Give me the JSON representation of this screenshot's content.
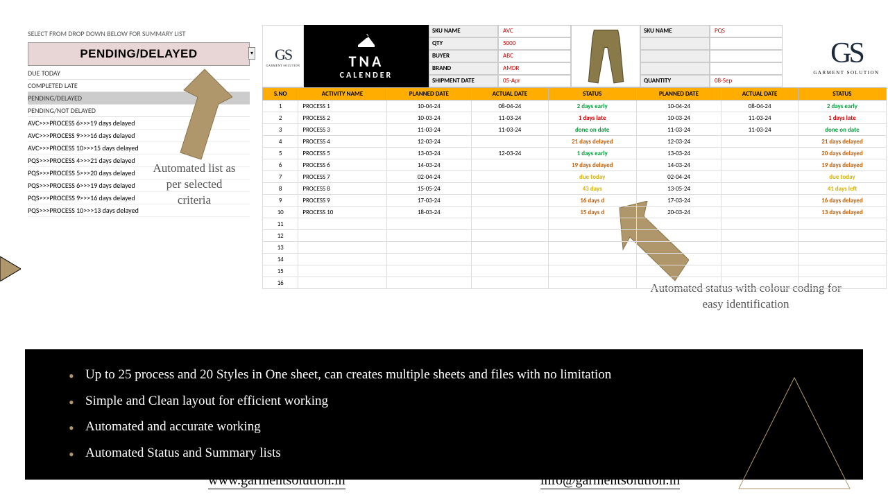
{
  "left": {
    "select_label": "SELECT FROM DROP DOWN BELOW FOR SUMMARY LIST",
    "banner": "PENDING/DELAYED",
    "options": [
      "DUE TODAY",
      "COMPLETED LATE",
      "PENDING/DELAYED",
      "PENDING/NOT DELAYED"
    ],
    "delayed_rows": [
      "AVC>>>PROCESS 6>>>19 days delayed",
      "AVC>>>PROCESS 9>>>16 days delayed",
      "AVC>>>PROCESS 10>>>15 days delayed",
      "PQS>>>PROCESS 4>>>21 days delayed",
      "PQS>>>PROCESS 5>>>20 days delayed",
      "PQS>>>PROCESS 6>>>19 days delayed",
      "PQS>>>PROCESS 9>>>16 days delayed",
      "PQS>>>PROCESS 10>>>13 days delayed"
    ]
  },
  "anno1": "Automated list as per selected criteria",
  "anno2": "Automated status with colour coding for easy identification",
  "meta1": {
    "sku_k": "SKU NAME",
    "sku_v": "AVC",
    "qty_k": "QTY",
    "qty_v": "5000",
    "buyer_k": "BUYER",
    "buyer_v": "ABC",
    "brand_k": "BRAND",
    "brand_v": "AMDR",
    "ship_k": "SHIPMENT DATE",
    "ship_v": "05-Apr"
  },
  "meta2": {
    "sku_k": "SKU NAME",
    "sku_v": "PQS",
    "qty_k": "QUANTITY",
    "qty_v": "08-Sep"
  },
  "tna": {
    "t": "TNA",
    "c": "CALENDER"
  },
  "headers": [
    "S.NO",
    "ACTIVITY NAME",
    "PLANNED DATE",
    "ACTUAL DATE",
    "STATUS",
    "PLANNED DATE",
    "ACTUAL DATE",
    "STATUS"
  ],
  "rows": [
    {
      "n": "1",
      "act": "PROCESS 1",
      "p1": "10-04-24",
      "a1": "08-04-24",
      "s1": "2 days early",
      "c1": "st-early",
      "p2": "10-04-24",
      "a2": "08-04-24",
      "s2": "2 days early",
      "c2": "st-early"
    },
    {
      "n": "2",
      "act": "PROCESS 2",
      "p1": "10-03-24",
      "a1": "11-03-24",
      "s1": "1 days late",
      "c1": "st-late",
      "p2": "10-03-24",
      "a2": "11-03-24",
      "s2": "1 days late",
      "c2": "st-late"
    },
    {
      "n": "3",
      "act": "PROCESS 3",
      "p1": "11-03-24",
      "a1": "11-03-24",
      "s1": "done on date",
      "c1": "st-done",
      "p2": "11-03-24",
      "a2": "11-03-24",
      "s2": "done on date",
      "c2": "st-done"
    },
    {
      "n": "4",
      "act": "PROCESS 4",
      "p1": "12-03-24",
      "a1": "",
      "s1": "21 days delayed",
      "c1": "st-delayed",
      "p2": "12-03-24",
      "a2": "",
      "s2": "21 days delayed",
      "c2": "st-delayed"
    },
    {
      "n": "5",
      "act": "PROCESS 5",
      "p1": "13-03-24",
      "a1": "12-03-24",
      "s1": "1 days early",
      "c1": "st-early",
      "p2": "13-03-24",
      "a2": "",
      "s2": "20 days delayed",
      "c2": "st-delayed"
    },
    {
      "n": "6",
      "act": "PROCESS 6",
      "p1": "14-03-24",
      "a1": "",
      "s1": "19 days delayed",
      "c1": "st-delayed",
      "p2": "14-03-24",
      "a2": "",
      "s2": "19 days delayed",
      "c2": "st-delayed"
    },
    {
      "n": "7",
      "act": "PROCESS 7",
      "p1": "02-04-24",
      "a1": "",
      "s1": "due today",
      "c1": "st-due",
      "p2": "02-04-24",
      "a2": "",
      "s2": "due today",
      "c2": "st-due"
    },
    {
      "n": "8",
      "act": "PROCESS 8",
      "p1": "15-05-24",
      "a1": "",
      "s1": "43 days",
      "c1": "st-left",
      "p2": "13-05-24",
      "a2": "",
      "s2": "41 days left",
      "c2": "st-left"
    },
    {
      "n": "9",
      "act": "PROCESS 9",
      "p1": "17-03-24",
      "a1": "",
      "s1": "16 days d",
      "c1": "st-delayed",
      "p2": "17-03-24",
      "a2": "",
      "s2": "16 days delayed",
      "c2": "st-delayed"
    },
    {
      "n": "10",
      "act": "PROCESS 10",
      "p1": "18-03-24",
      "a1": "",
      "s1": "15 days d",
      "c1": "st-delayed",
      "p2": "20-03-24",
      "a2": "",
      "s2": "13 days delayed",
      "c2": "st-delayed"
    }
  ],
  "empty_rows": [
    "11",
    "12",
    "13",
    "14",
    "15",
    "16"
  ],
  "bullets": [
    "Up to 25 process and 20 Styles in One sheet, can creates multiple sheets and files with no limitation",
    "Simple and Clean layout for efficient working",
    "Automated and accurate working",
    "Automated Status and Summary lists"
  ],
  "footer": {
    "url": "www.garmentsolution.in",
    "email": "info@garmentsolution.in"
  },
  "gs": {
    "big": "GS",
    "tiny": "GARMENT SOLUTION"
  }
}
